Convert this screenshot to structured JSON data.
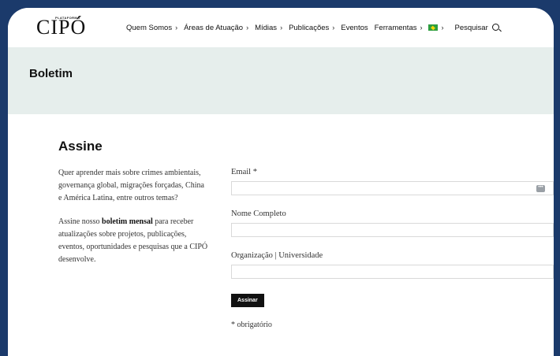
{
  "logo": {
    "small_text": "PLATAFORMA",
    "main_text": "CIPÓ"
  },
  "nav": {
    "items": [
      {
        "label": "Quem Somos"
      },
      {
        "label": "Áreas de Atuação"
      },
      {
        "label": "Mídias"
      },
      {
        "label": "Publicações"
      },
      {
        "label": "Eventos"
      },
      {
        "label": "Ferramentas"
      }
    ],
    "language_icon": "brazil-flag-icon",
    "search_label": "Pesquisar",
    "search_icon": "search-icon"
  },
  "hero": {
    "title": "Boletim"
  },
  "section": {
    "title": "Assine",
    "paragraph1": "Quer aprender mais sobre crimes ambientais, governança global, migrações forçadas, China e América Latina, entre outros temas?",
    "paragraph2_prefix": "Assine nosso ",
    "paragraph2_bold": "boletim mensal",
    "paragraph2_suffix": " para receber atualizações sobre projetos, publicações, eventos, oportunidades e pesquisas que a CIPÓ desenvolve."
  },
  "form": {
    "email_label": "Email *",
    "email_value": "",
    "name_label": "Nome Completo",
    "name_value": "",
    "org_label": "Organização | Universidade",
    "org_value": "",
    "submit_label": "Assinar",
    "required_note": "* obrigatório"
  },
  "colors": {
    "frame": "#1b3a6b",
    "hero_bg": "#e6eeec",
    "button": "#111111"
  }
}
